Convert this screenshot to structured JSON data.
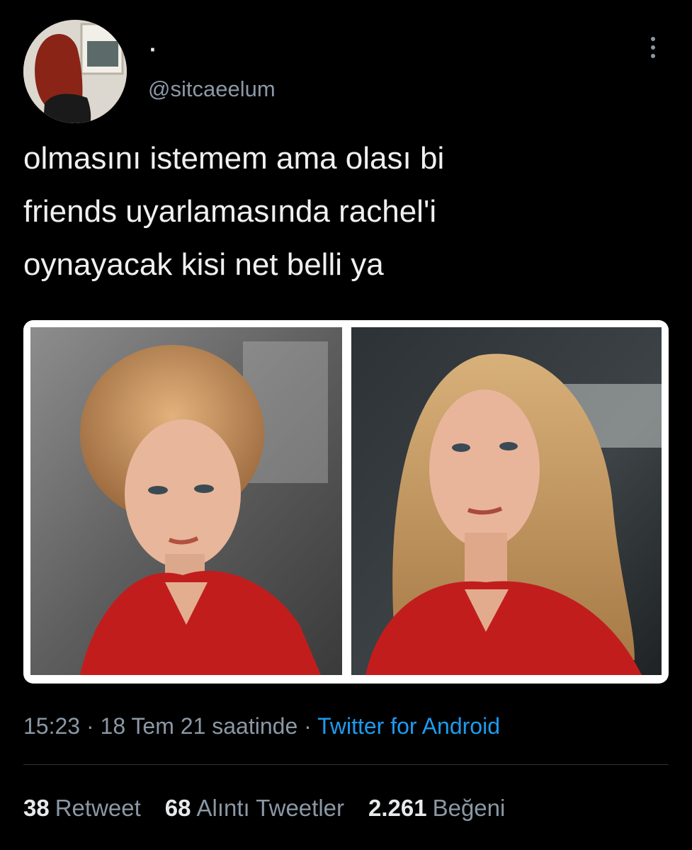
{
  "tweet": {
    "display_name": "·",
    "handle": "@sitcaeelum",
    "text": "olmasını istemem ama olası bi\nfriends uyarlamasında rachel'i\noynayacak kisi net belli ya",
    "time": "15:23",
    "separator": "·",
    "date": "18 Tem 21 saatinde",
    "source": "Twitter for Android",
    "more_icon": "more-vertical-icon"
  },
  "stats": {
    "retweets_count": "38",
    "retweets_label": "Retweet",
    "quotes_count": "68",
    "quotes_label": "Alıntı Tweetler",
    "likes_count": "2.261",
    "likes_label": "Beğeni"
  },
  "colors": {
    "background": "#000000",
    "text": "#e7e9ea",
    "muted": "#8b98a5",
    "link": "#1d9bf0",
    "shirt_red": "#c21d1d"
  }
}
